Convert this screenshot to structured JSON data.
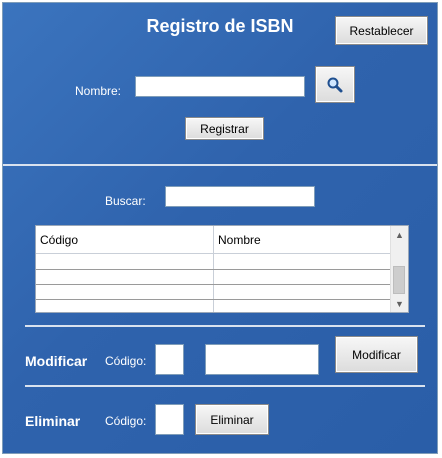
{
  "title": "Registro de ISBN",
  "buttons": {
    "reset": "Restablecer",
    "register": "Registrar",
    "modify": "Modificar",
    "delete": "Eliminar"
  },
  "register": {
    "name_label": "Nombre:",
    "name_value": ""
  },
  "search": {
    "label": "Buscar:",
    "value": ""
  },
  "table": {
    "columns": [
      "Código",
      "Nombre"
    ],
    "rows": [
      [
        "",
        ""
      ],
      [
        "",
        ""
      ],
      [
        "",
        ""
      ],
      [
        "",
        ""
      ]
    ]
  },
  "modify": {
    "section_label": "Modificar",
    "code_label": "Código:",
    "code_value": "",
    "name_value": ""
  },
  "delete": {
    "section_label": "Eliminar",
    "code_label": "Código:",
    "code_value": ""
  },
  "icons": {
    "search_button": "magnifier-icon",
    "scroll_up": "scroll-up-icon",
    "scroll_down": "scroll-down-icon"
  }
}
